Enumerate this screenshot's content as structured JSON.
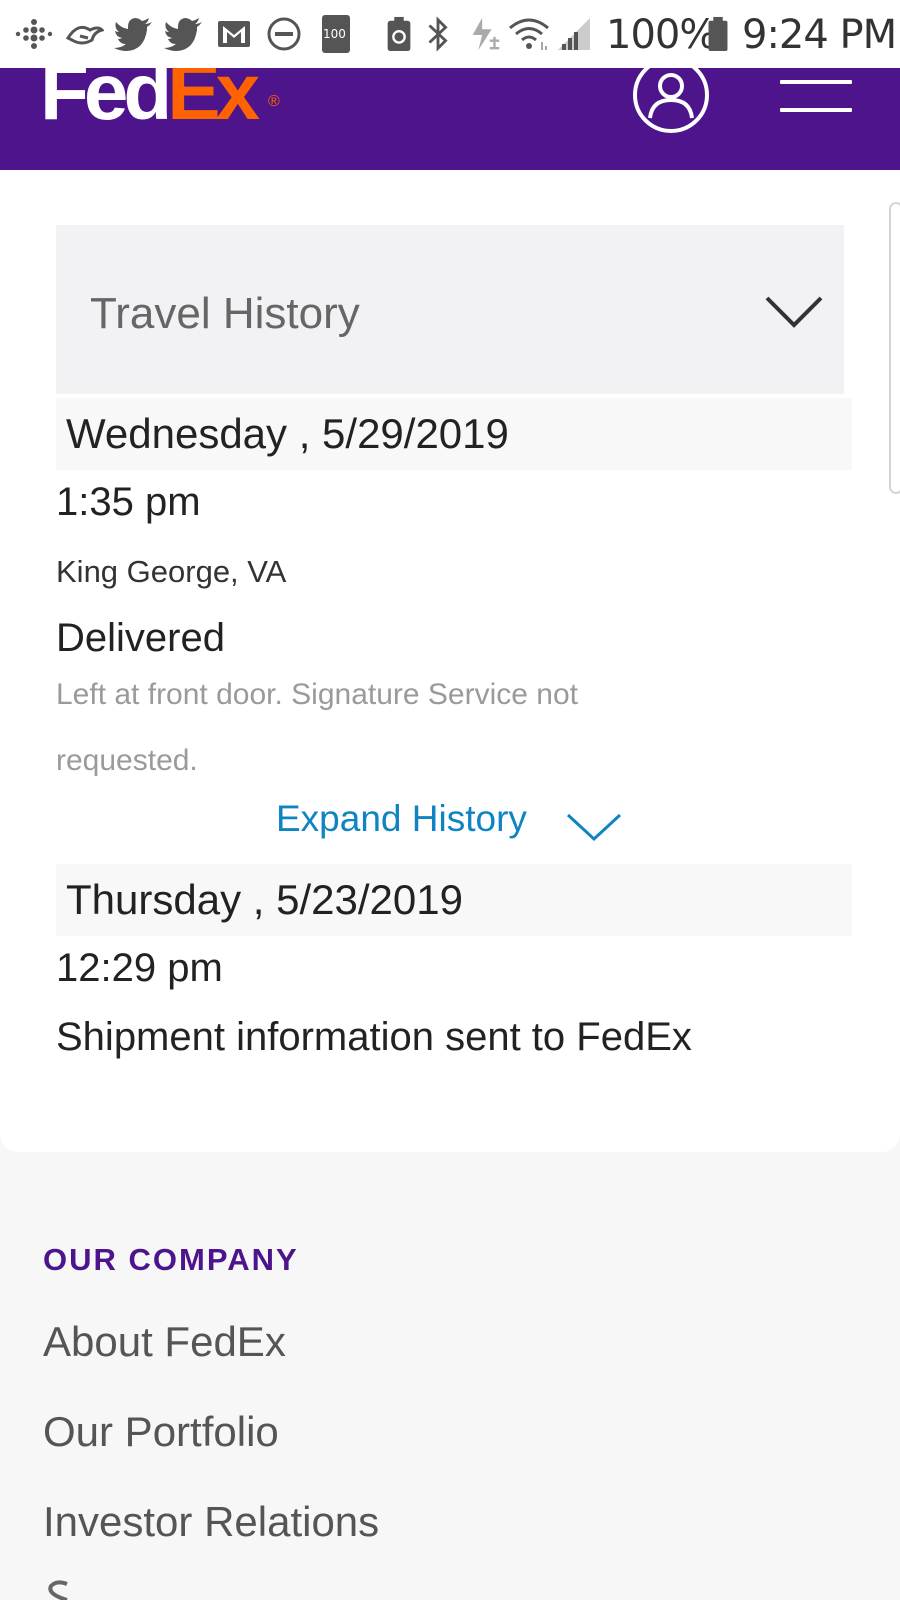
{
  "status_bar": {
    "battery": "100%",
    "time": "9:24 PM",
    "storage_badge": "100"
  },
  "header": {
    "logo_fed": "Fed",
    "logo_ex": "Ex",
    "logo_reg": "®"
  },
  "travel_history": {
    "title": "Travel History",
    "events": [
      {
        "date": "Wednesday , 5/29/2019",
        "time": "1:35 pm",
        "location": "King George, VA",
        "status": "Delivered",
        "detail": "Left at front door. Signature Service not requested."
      }
    ],
    "expand_label": "Expand History",
    "last_event": {
      "date": "Thursday , 5/23/2019",
      "time": "12:29 pm",
      "status": "Shipment information sent to FedEx"
    }
  },
  "footer": {
    "heading": "OUR COMPANY",
    "links": [
      "About FedEx",
      "Our Portfolio",
      "Investor Relations"
    ]
  },
  "colors": {
    "brand_purple": "#4d148c",
    "brand_orange": "#ff6200",
    "link_blue": "#0f84c2"
  }
}
